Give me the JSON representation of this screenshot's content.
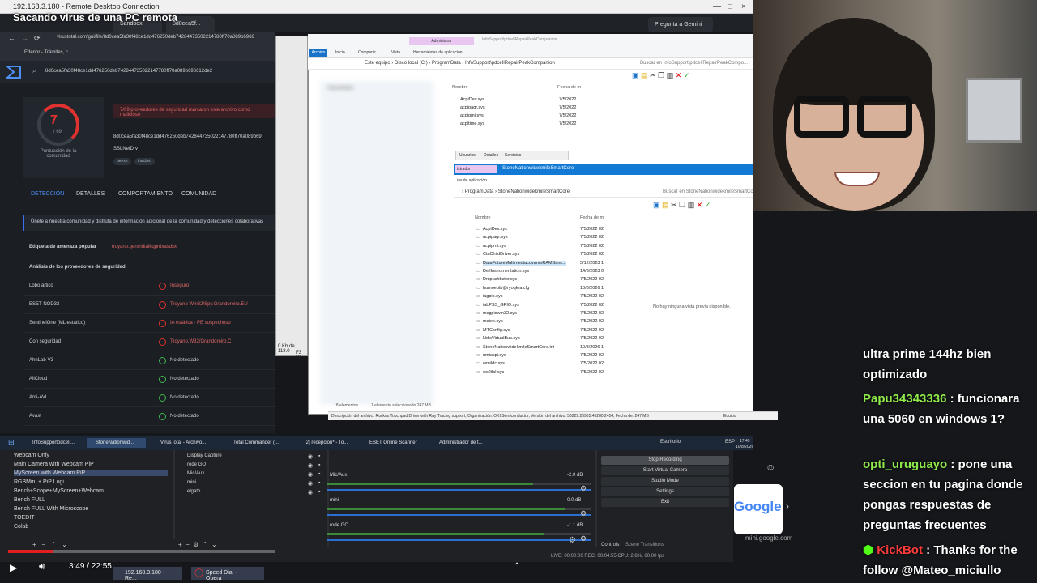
{
  "rdp": {
    "title": "192.168.3.180 - Remote Desktop Connection"
  },
  "video": {
    "title": "Sacando virus de una PC remota",
    "time": "3:49 / 22:55",
    "progress": 0.167
  },
  "chrome": {
    "tabs": [
      "Sandbox",
      "8d0cea5f..."
    ],
    "gemini": "Pregunta a Gemini",
    "url": "virustotal.com/gui/file/8d0cea5fa30f48ce1dd476250deb74284473502214780ff70a089b6966",
    "bookmark": "Edenor - Trámites, c..."
  },
  "virustotal": {
    "hash": "8d0cea5fa30f48ce1dd476250deb742844735022147780ff70a089b696612de2",
    "score": "7",
    "score_den": "/ 69",
    "score_label": "Puntuación de la comunidad",
    "alert": "7/69 proveedores de seguridad marcaron este archivo como malicioso",
    "hash_short": "8d0cea5fa30f48ce1dd476250deb742844735022147780ff70a089b69",
    "filename": "SSLNetDrv",
    "tags": [
      "peexe",
      "inactivo"
    ],
    "tabs": [
      "DETECCIÓN",
      "DETALLES",
      "COMPORTAMIENTO",
      "COMUNIDAD"
    ],
    "community": "Únete a nuestra comunidad y disfruta de información adicional de la comunidad y detecciones colaborativas",
    "threat_label": "Etiqueta de amenaza popular",
    "threat_value": "troyano.gen/rldtaikqprdxasdsx",
    "analysis_label": "Análisis de los proveedores de seguridad",
    "rows": [
      {
        "engine": "Lobo ártico",
        "result": "Inseguro",
        "status": "bad"
      },
      {
        "engine": "ESET-NOD32",
        "result": "Troyano Win32/Spy.Grandoreiro.EU",
        "status": "bad"
      },
      {
        "engine": "SentinelOne (ML estático)",
        "result": "IA estática - PE sospechoso",
        "status": "bad"
      },
      {
        "engine": "Con seguridad",
        "result": "Troyano.W32/Grandoreiro.C",
        "status": "bad"
      },
      {
        "engine": "AhnLab-V3",
        "result": "No detectado",
        "status": "ok"
      },
      {
        "engine": "AliCloud",
        "result": "No detectado",
        "status": "ok"
      },
      {
        "engine": "Anti-AVL",
        "result": "No detectado",
        "status": "ok"
      },
      {
        "engine": "Avast",
        "result": "No detectado",
        "status": "ok"
      }
    ]
  },
  "explorer": {
    "ribbon_tabs": [
      "Archivo",
      "Inicio",
      "Compartir",
      "Vista"
    ],
    "context_tab": "Administrar",
    "context_sub": "Herramientas de aplicación",
    "window_title": "InfoSupport\\pdceIlRepairPeakCompanion",
    "path": "Este equipo  ›  Disco local (C:)  ›  ProgramData  ›  InfoSupport\\pdceIlRepairPeakCompanion",
    "search": "Buscar en InfoSupport\\pdceIlRepairPeakCompo...",
    "col_name": "Nombre",
    "col_date": "Fecha de m",
    "left_header": "Documentos",
    "files": [
      "AcpiDev.sys",
      "acpipagr.sys",
      "acpipmi.sys",
      "acpitime.sys"
    ],
    "dates": [
      "7/5/2022",
      "7/5/2022",
      "7/5/2022",
      "7/5/2022"
    ],
    "small_tabs": [
      "Usuarios",
      "Detalles",
      "Servicios"
    ],
    "side_text": "0 Kb de 118.0",
    "side_text2": "F3 Ve"
  },
  "dialog2": {
    "title": "StoneNationwidekmileSmartCore",
    "tab": "istrador",
    "sub": "ias de aplicación",
    "path": "›  ProgramData  ›  StoneNationwidekmileSmartCore",
    "search": "Buscar en StoneNationwidekmileSmartCore",
    "col_name": "Nombre",
    "col_date": "Fecha de m",
    "files": [
      {
        "name": "AcpiDev.sys",
        "date": "7/5/2022 02"
      },
      {
        "name": "acpipagr.sys",
        "date": "7/5/2022 02"
      },
      {
        "name": "acpipmi.sys",
        "date": "7/5/2022 02"
      },
      {
        "name": "CtaChildDriver.sys",
        "date": "7/5/2022 02"
      },
      {
        "name": "DataFutureMultimediacovanmRAMBanc...",
        "date": "5/12/2023 1"
      },
      {
        "name": "DellInstrumentation.sys",
        "date": "14/3/2023 0"
      },
      {
        "name": "Dmpushbstor.sys",
        "date": "7/5/2022 02"
      },
      {
        "name": "humoebtb@ryoqkra.cfg",
        "date": "10/8/2026 1"
      },
      {
        "name": "iagpio.sys",
        "date": "7/5/2022 02"
      },
      {
        "name": "iaLPSS_GPIO.sys",
        "date": "7/5/2022 02"
      },
      {
        "name": "msgpiowin32.sys",
        "date": "7/5/2022 02"
      },
      {
        "name": "mstee.sys",
        "date": "7/5/2022 02"
      },
      {
        "name": "MTConfig.sys",
        "date": "7/5/2022 02"
      },
      {
        "name": "NdisVirtualBus.sys",
        "date": "7/5/2022 02"
      },
      {
        "name": "StoneNationwidekmileSmartCore.ini",
        "date": "10/8/2026 1"
      },
      {
        "name": "umiacpi.sys",
        "date": "7/5/2022 02"
      },
      {
        "name": "wmiIdc.sys",
        "date": "7/5/2022 02"
      },
      {
        "name": "ws2ifsl.sys",
        "date": "7/5/2022 02"
      }
    ],
    "preview": "No hay ninguna vista previa disponible.",
    "count": "18 elementos",
    "selected": "1 elemento seleccionado  247 MB",
    "status": "Descripción del archivo: Ruckus Touchpad Driver with Ray Tracing support, Organización: OKI Semiconductor, Versión del archivo: 56229.25965.45280.2454, Fecha de: 247 MB",
    "equipo": "Equipo"
  },
  "taskbar": {
    "items": [
      "InfoSupportpdceIl...",
      "StoneNationwid...",
      "VirusTotal - Archivo...",
      "Total Commander (...",
      "[2] recepcion* - To...",
      "ESET Online Scanner",
      "Administrador de t..."
    ],
    "desktop": "Escritorio",
    "lang": "ESP",
    "clock": "17:49",
    "date": "10/8/2026"
  },
  "obs": {
    "scenes": [
      "Webcam Only",
      "Main Camera with Webcam PiP",
      "MyScreen with Webcam PiP",
      "RGBMini + PiP Logi",
      "Bench+Scope+MyScreen+Webcam",
      "Bench FULL",
      "Bench FULL With Microscope",
      "TOEDIT",
      "Colab"
    ],
    "sources": [
      "Display Capture",
      "rode GO",
      "Mic/Aux",
      "mini",
      "elgato"
    ],
    "mixer": [
      {
        "label": "Mic/Aux",
        "db": "-2.0 dB",
        "level": 0.78
      },
      {
        "label": "mini",
        "db": "0.0 dB",
        "level": 0.9
      },
      {
        "label": "rode GO",
        "db": "-1.1 dB",
        "level": 0.82
      }
    ],
    "controls": [
      "Stop Recording",
      "Start Virtual Camera",
      "Studio Mode",
      "Settings",
      "Exit"
    ],
    "tabs": [
      "Controls",
      "Scene Transitions"
    ],
    "status": "LIVE: 00:00:00     REC: 00:04:55     CPU: 2.8%, 60.00 fps"
  },
  "chat": {
    "lines": [
      {
        "user": "",
        "text": "ultra prime 144hz bien optimizado"
      },
      {
        "user": "Papu34343336",
        "text": "funcionara una 5060 en windows 1?"
      },
      {
        "user": "opti_uruguayo",
        "text": "pone una seccion en tu pagina donde pongas respuestas de preguntas frecuentes"
      },
      {
        "user": "KickBot",
        "text": "Thanks for the follow @Mateo_miciullo"
      }
    ]
  },
  "google": {
    "text": "Google",
    "url": "mini.google.com"
  },
  "bottom_taskbar": {
    "items": [
      "192.168.3.180 - Re...",
      "Speed Dial - Opera"
    ]
  },
  "colors": {
    "accent_red": "#e0322e",
    "ok_green": "#3fb950",
    "vt_bg": "#1b1f24",
    "win_blue": "#1279d4",
    "chat_user": "#8eea4a"
  }
}
